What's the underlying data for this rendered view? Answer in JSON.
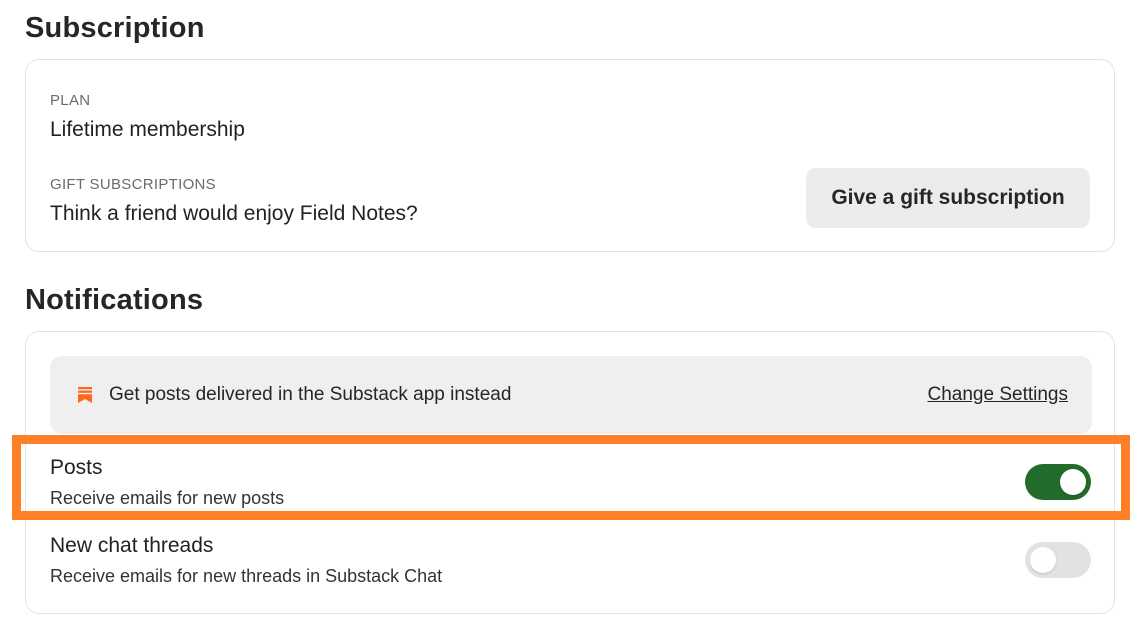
{
  "subscription": {
    "title": "Subscription",
    "plan_label": "PLAN",
    "plan_value": "Lifetime membership",
    "gift_label": "GIFT SUBSCRIPTIONS",
    "gift_value": "Think a friend would enjoy Field Notes?",
    "gift_button_label": "Give a gift subscription"
  },
  "notifications": {
    "title": "Notifications",
    "banner": {
      "icon": "substack-bookmark-icon",
      "text": "Get posts delivered in the Substack app instead",
      "link_label": "Change Settings"
    },
    "rows": [
      {
        "title": "Posts",
        "description": "Receive emails for new posts",
        "enabled": true
      },
      {
        "title": "New chat threads",
        "description": "Receive emails for new threads in Substack Chat",
        "enabled": false
      }
    ]
  },
  "colors": {
    "accent_orange": "#ff7f27",
    "substack_orange": "#ff6719",
    "toggle_on": "#236b2a",
    "toggle_off": "#e2e2e2"
  }
}
